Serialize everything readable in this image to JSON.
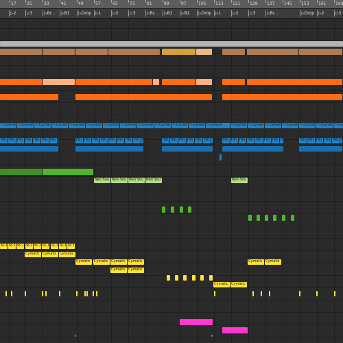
{
  "ruler": {
    "bars": [
      "17",
      "25",
      "33",
      "41",
      "49",
      "57",
      "65",
      "73",
      "81",
      "89",
      "97",
      "105",
      "113",
      "121",
      "129",
      "137",
      "145",
      "153",
      "161",
      "169"
    ]
  },
  "locators": [
    "2",
    "3",
    "Br...",
    "B1",
    "Drop",
    "1",
    "2",
    "3",
    "Br...",
    "B1",
    "B2",
    "Drop",
    "1",
    "2",
    "3",
    "Br...",
    "Drop",
    "2",
    "3"
  ],
  "clip_labels": {
    "cymat": "!!-Cymat",
    "hihat": "Hihat Cli",
    "neo": "Neo Sou",
    "sc": "SC1 23 0",
    "cymatic": "Cymatic"
  },
  "colors": {
    "background": "#2a2a2a",
    "ruler": "#5d5d5d",
    "locator_strip": "#3c3c3c",
    "gray_clip": "#b4b4b4",
    "brown_clip": "#b07a52",
    "gold_clip": "#d6a03a",
    "peach_clip": "#e6ba80",
    "orange_clip": "#ff6a14",
    "salmon_clip": "#ffb07e",
    "blue_clip": "#1f83c9",
    "green_clip": "#4fb52a",
    "lightgreen_clip": "#b6d98a",
    "yellow_clip": "#ffe233",
    "pink_clip": "#ff38d0"
  }
}
